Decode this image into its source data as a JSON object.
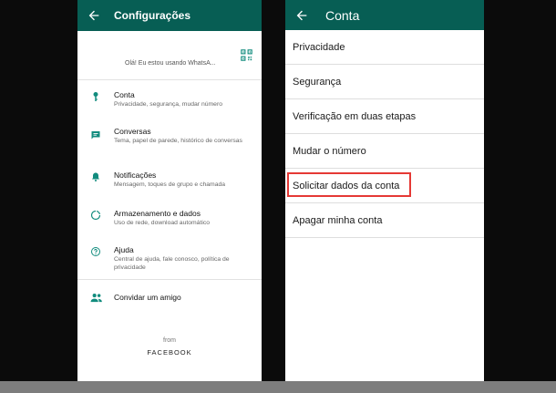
{
  "left_screen": {
    "title": "Configurações",
    "profile_status": "Olá! Eu estou usando WhatsA...",
    "items": [
      {
        "title": "Conta",
        "subtitle": "Privacidade, segurança, mudar número",
        "icon": "key-icon"
      },
      {
        "title": "Conversas",
        "subtitle": "Tema, papel de parede, histórico de conversas",
        "icon": "chat-icon"
      },
      {
        "title": "Notificações",
        "subtitle": "Mensagem, toques de grupo e chamada",
        "icon": "bell-icon"
      },
      {
        "title": "Armazenamento e dados",
        "subtitle": "Uso de rede, download automático",
        "icon": "data-usage-icon"
      },
      {
        "title": "Ajuda",
        "subtitle": "Central de ajuda, fale conosco, política de privacidade",
        "icon": "help-icon"
      }
    ],
    "invite_label": "Convidar um amigo",
    "from_label": "from",
    "brand_label": "FACEBOOK"
  },
  "right_screen": {
    "title": "Conta",
    "items": [
      {
        "label": "Privacidade"
      },
      {
        "label": "Segurança"
      },
      {
        "label": "Verificação em duas etapas"
      },
      {
        "label": "Mudar o número"
      },
      {
        "label": "Solicitar dados da conta",
        "highlighted": true
      },
      {
        "label": "Apagar minha conta"
      }
    ]
  },
  "colors": {
    "appbar": "#075e54",
    "icon": "#128c7e",
    "highlight": "#e53935"
  }
}
